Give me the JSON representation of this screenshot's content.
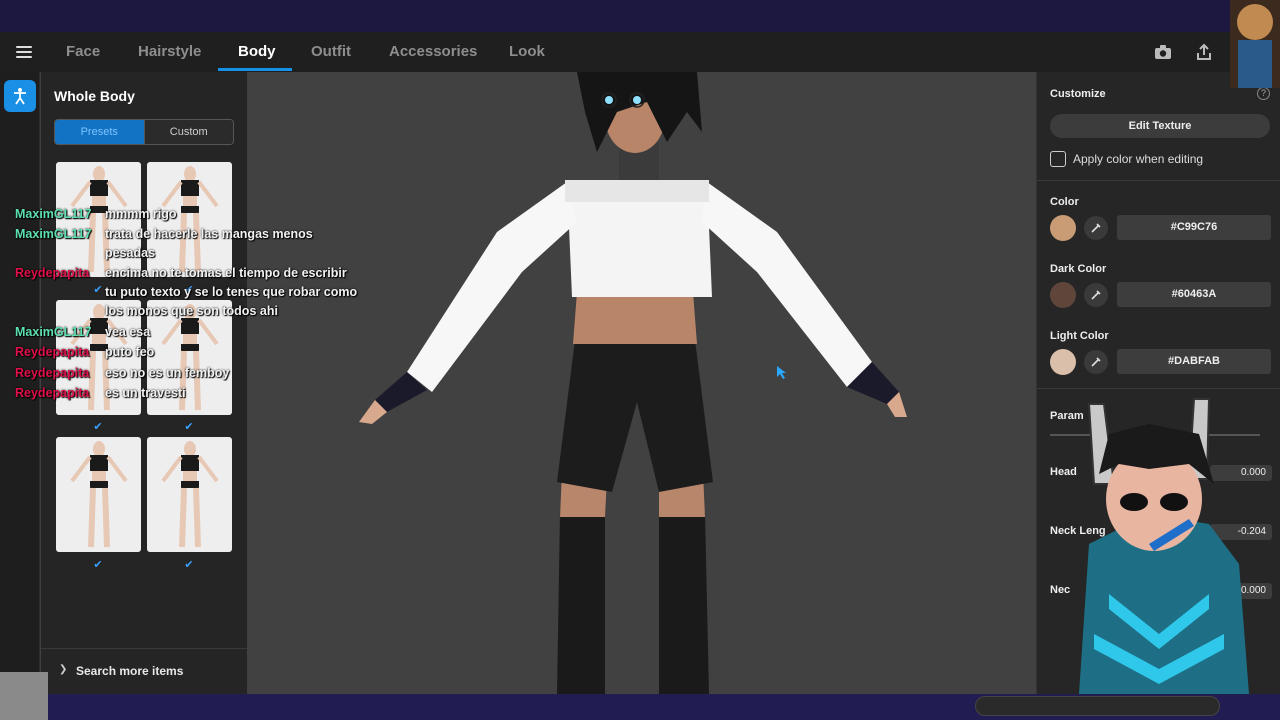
{
  "nav": {
    "tabs": [
      "Face",
      "Hairstyle",
      "Body",
      "Outfit",
      "Accessories",
      "Look"
    ],
    "active_tab": "Body"
  },
  "left_panel": {
    "title": "Whole Body",
    "segment": {
      "presets": "Presets",
      "custom": "Custom"
    },
    "presets_count": 6,
    "search_more": "Search more items"
  },
  "right_panel": {
    "customize": "Customize",
    "edit_texture": "Edit Texture",
    "apply_color": "Apply color when editing",
    "colors": [
      {
        "label": "Color",
        "hex": "#C99C76"
      },
      {
        "label": "Dark Color",
        "hex": "#60463A"
      },
      {
        "label": "Light Color",
        "hex": "#DABFAB"
      }
    ],
    "parameters": {
      "title": "Param",
      "rows": [
        {
          "label": "Head",
          "value": "0.000"
        },
        {
          "label": "Neck Leng",
          "value": "-0.204"
        },
        {
          "label": "Nec",
          "value": "100.000"
        }
      ]
    }
  },
  "chat": [
    {
      "user": "MaximGL117",
      "text": "mmmm rigo",
      "type": "maxim"
    },
    {
      "user": "MaximGL117",
      "text": "trata de hacerle las mangas menos",
      "text2": "pesadas",
      "type": "maxim"
    },
    {
      "user": "Reydepapita",
      "text": "encima no te tomas el tiempo de escribir",
      "text2": "tu puto texto y se lo tenes que robar como",
      "text3": "los monos que son todos ahi",
      "type": "rey"
    },
    {
      "user": "MaximGL117",
      "text": "vea esa",
      "type": "maxim"
    },
    {
      "user": "Reydepapita",
      "text": "puto feo",
      "type": "rey"
    },
    {
      "user": "Reydepapita",
      "text": "eso no es un femboy",
      "type": "rey"
    },
    {
      "user": "Reydepapita",
      "text": "es un travesti",
      "type": "rey"
    }
  ],
  "colors": {
    "accent": "#1592E6",
    "panel": "#252525",
    "viewport": "#414141"
  }
}
